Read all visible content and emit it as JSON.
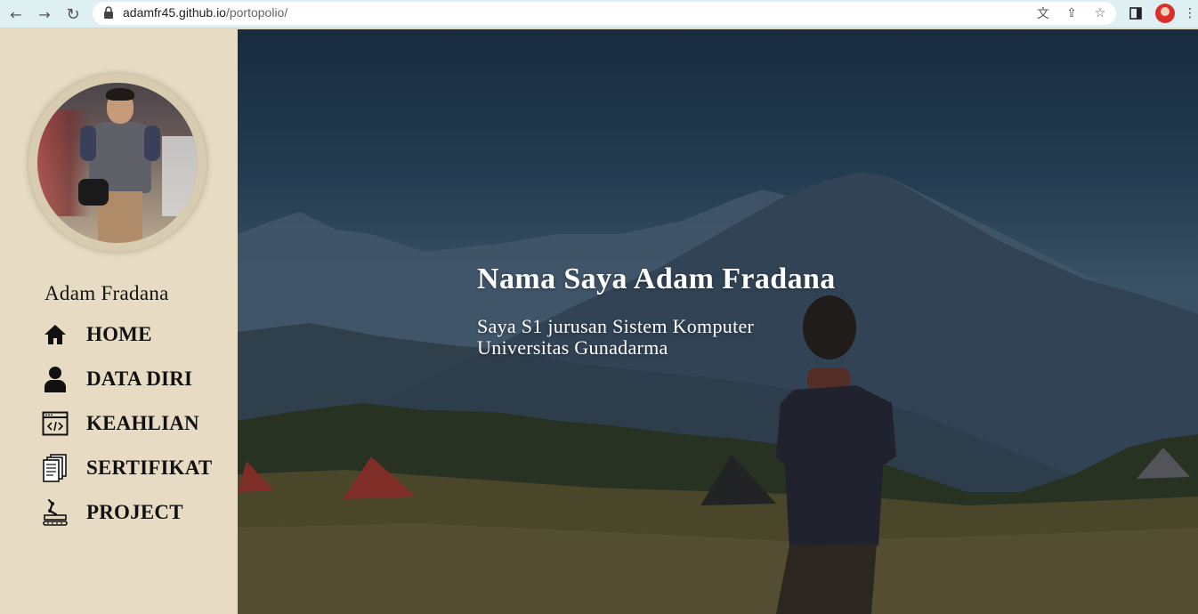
{
  "browser": {
    "url_host": "adamfr45.github.io",
    "url_path": "/portopolio/",
    "icons": [
      "back-arrow-icon",
      "forward-arrow-icon",
      "reload-icon",
      "lock-icon",
      "translate-icon",
      "share-icon",
      "star-icon",
      "sidepanel-icon",
      "profile-avatar",
      "menu-kebab-icon"
    ]
  },
  "sidebar": {
    "name": "Adam Fradana",
    "menu": [
      {
        "label": "HOME",
        "icon": "home-icon"
      },
      {
        "label": "DATA DIRI",
        "icon": "user-icon"
      },
      {
        "label": "KEAHLIAN",
        "icon": "code-window-icon"
      },
      {
        "label": "SERTIFIKAT",
        "icon": "documents-icon"
      },
      {
        "label": "PROJECT",
        "icon": "project-robot-arm-icon"
      }
    ]
  },
  "hero": {
    "title": "Nama Saya Adam Fradana",
    "subtitle_line1": "Saya S1 jurusan Sistem Komputer",
    "subtitle_line2": "Universitas Gunadarma"
  },
  "colors": {
    "sidebar_bg": "#e7dcc3",
    "browser_bar": "#dff0f3",
    "text_dark": "#111111",
    "hero_text": "#ffffff"
  }
}
